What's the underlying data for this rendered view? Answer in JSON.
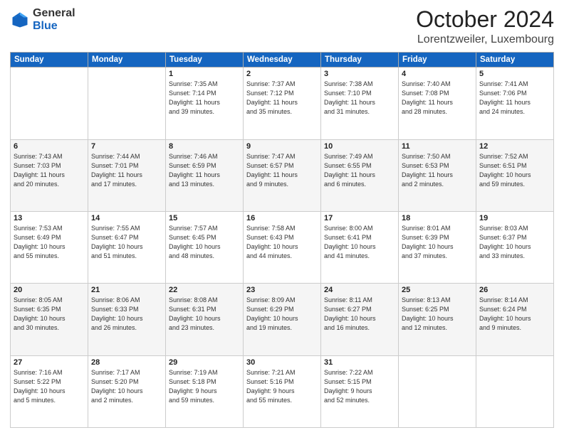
{
  "header": {
    "logo_general": "General",
    "logo_blue": "Blue",
    "month_title": "October 2024",
    "location": "Lorentzweiler, Luxembourg"
  },
  "weekdays": [
    "Sunday",
    "Monday",
    "Tuesday",
    "Wednesday",
    "Thursday",
    "Friday",
    "Saturday"
  ],
  "weeks": [
    [
      {
        "day": "",
        "info": ""
      },
      {
        "day": "",
        "info": ""
      },
      {
        "day": "1",
        "info": "Sunrise: 7:35 AM\nSunset: 7:14 PM\nDaylight: 11 hours\nand 39 minutes."
      },
      {
        "day": "2",
        "info": "Sunrise: 7:37 AM\nSunset: 7:12 PM\nDaylight: 11 hours\nand 35 minutes."
      },
      {
        "day": "3",
        "info": "Sunrise: 7:38 AM\nSunset: 7:10 PM\nDaylight: 11 hours\nand 31 minutes."
      },
      {
        "day": "4",
        "info": "Sunrise: 7:40 AM\nSunset: 7:08 PM\nDaylight: 11 hours\nand 28 minutes."
      },
      {
        "day": "5",
        "info": "Sunrise: 7:41 AM\nSunset: 7:06 PM\nDaylight: 11 hours\nand 24 minutes."
      }
    ],
    [
      {
        "day": "6",
        "info": "Sunrise: 7:43 AM\nSunset: 7:03 PM\nDaylight: 11 hours\nand 20 minutes."
      },
      {
        "day": "7",
        "info": "Sunrise: 7:44 AM\nSunset: 7:01 PM\nDaylight: 11 hours\nand 17 minutes."
      },
      {
        "day": "8",
        "info": "Sunrise: 7:46 AM\nSunset: 6:59 PM\nDaylight: 11 hours\nand 13 minutes."
      },
      {
        "day": "9",
        "info": "Sunrise: 7:47 AM\nSunset: 6:57 PM\nDaylight: 11 hours\nand 9 minutes."
      },
      {
        "day": "10",
        "info": "Sunrise: 7:49 AM\nSunset: 6:55 PM\nDaylight: 11 hours\nand 6 minutes."
      },
      {
        "day": "11",
        "info": "Sunrise: 7:50 AM\nSunset: 6:53 PM\nDaylight: 11 hours\nand 2 minutes."
      },
      {
        "day": "12",
        "info": "Sunrise: 7:52 AM\nSunset: 6:51 PM\nDaylight: 10 hours\nand 59 minutes."
      }
    ],
    [
      {
        "day": "13",
        "info": "Sunrise: 7:53 AM\nSunset: 6:49 PM\nDaylight: 10 hours\nand 55 minutes."
      },
      {
        "day": "14",
        "info": "Sunrise: 7:55 AM\nSunset: 6:47 PM\nDaylight: 10 hours\nand 51 minutes."
      },
      {
        "day": "15",
        "info": "Sunrise: 7:57 AM\nSunset: 6:45 PM\nDaylight: 10 hours\nand 48 minutes."
      },
      {
        "day": "16",
        "info": "Sunrise: 7:58 AM\nSunset: 6:43 PM\nDaylight: 10 hours\nand 44 minutes."
      },
      {
        "day": "17",
        "info": "Sunrise: 8:00 AM\nSunset: 6:41 PM\nDaylight: 10 hours\nand 41 minutes."
      },
      {
        "day": "18",
        "info": "Sunrise: 8:01 AM\nSunset: 6:39 PM\nDaylight: 10 hours\nand 37 minutes."
      },
      {
        "day": "19",
        "info": "Sunrise: 8:03 AM\nSunset: 6:37 PM\nDaylight: 10 hours\nand 33 minutes."
      }
    ],
    [
      {
        "day": "20",
        "info": "Sunrise: 8:05 AM\nSunset: 6:35 PM\nDaylight: 10 hours\nand 30 minutes."
      },
      {
        "day": "21",
        "info": "Sunrise: 8:06 AM\nSunset: 6:33 PM\nDaylight: 10 hours\nand 26 minutes."
      },
      {
        "day": "22",
        "info": "Sunrise: 8:08 AM\nSunset: 6:31 PM\nDaylight: 10 hours\nand 23 minutes."
      },
      {
        "day": "23",
        "info": "Sunrise: 8:09 AM\nSunset: 6:29 PM\nDaylight: 10 hours\nand 19 minutes."
      },
      {
        "day": "24",
        "info": "Sunrise: 8:11 AM\nSunset: 6:27 PM\nDaylight: 10 hours\nand 16 minutes."
      },
      {
        "day": "25",
        "info": "Sunrise: 8:13 AM\nSunset: 6:25 PM\nDaylight: 10 hours\nand 12 minutes."
      },
      {
        "day": "26",
        "info": "Sunrise: 8:14 AM\nSunset: 6:24 PM\nDaylight: 10 hours\nand 9 minutes."
      }
    ],
    [
      {
        "day": "27",
        "info": "Sunrise: 7:16 AM\nSunset: 5:22 PM\nDaylight: 10 hours\nand 5 minutes."
      },
      {
        "day": "28",
        "info": "Sunrise: 7:17 AM\nSunset: 5:20 PM\nDaylight: 10 hours\nand 2 minutes."
      },
      {
        "day": "29",
        "info": "Sunrise: 7:19 AM\nSunset: 5:18 PM\nDaylight: 9 hours\nand 59 minutes."
      },
      {
        "day": "30",
        "info": "Sunrise: 7:21 AM\nSunset: 5:16 PM\nDaylight: 9 hours\nand 55 minutes."
      },
      {
        "day": "31",
        "info": "Sunrise: 7:22 AM\nSunset: 5:15 PM\nDaylight: 9 hours\nand 52 minutes."
      },
      {
        "day": "",
        "info": ""
      },
      {
        "day": "",
        "info": ""
      }
    ]
  ]
}
